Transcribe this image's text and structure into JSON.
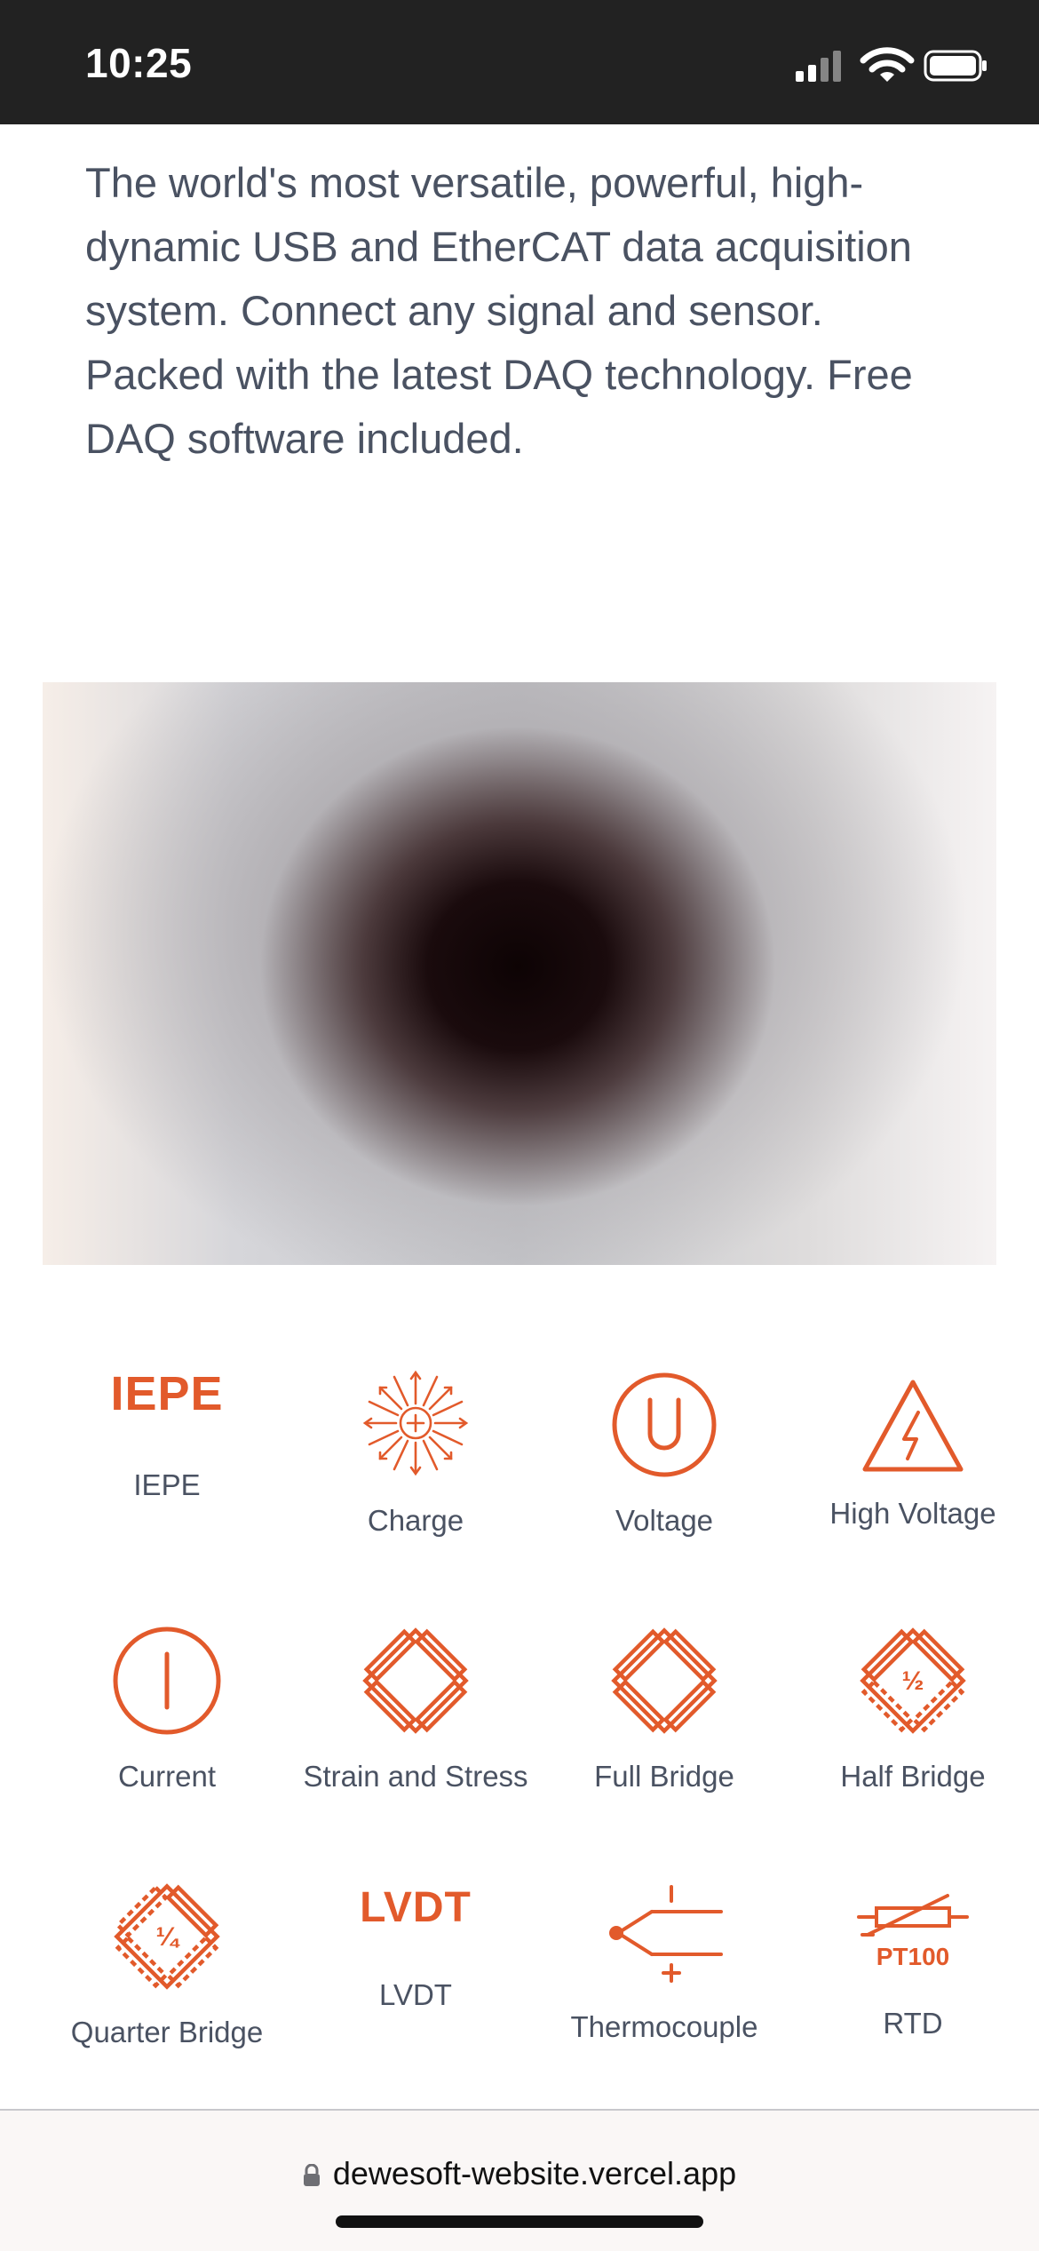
{
  "status_bar": {
    "time": "10:25",
    "signal_icon": "cellular-signal-icon",
    "wifi_icon": "wifi-icon",
    "battery_icon": "battery-icon"
  },
  "description": "The world's most versatile, powerful, high-dynamic USB and EtherCAT data acquisition system. Connect any signal and sensor. Packed with the latest DAQ technology. Free DAQ software included.",
  "hero": {
    "icon": "blurred-product-image"
  },
  "accent_color": "#e25a2b",
  "inputs": [
    {
      "label": "IEPE",
      "icon": "iepe-text-icon",
      "icon_text": "IEPE"
    },
    {
      "label": "Charge",
      "icon": "charge-icon"
    },
    {
      "label": "Voltage",
      "icon": "voltage-icon",
      "icon_text": "U"
    },
    {
      "label": "High Voltage",
      "icon": "high-voltage-icon"
    },
    {
      "label": "Current",
      "icon": "current-icon"
    },
    {
      "label": "Strain and Stress",
      "icon": "strain-bridge-icon"
    },
    {
      "label": "Full Bridge",
      "icon": "full-bridge-icon"
    },
    {
      "label": "Half Bridge",
      "icon": "half-bridge-icon",
      "icon_text": "½"
    },
    {
      "label": "Quarter Bridge",
      "icon": "quarter-bridge-icon",
      "icon_text": "¼"
    },
    {
      "label": "LVDT",
      "icon": "lvdt-text-icon",
      "icon_text": "LVDT"
    },
    {
      "label": "Thermocouple",
      "icon": "thermocouple-icon"
    },
    {
      "label": "RTD",
      "icon": "rtd-icon",
      "icon_text": "PT100"
    }
  ],
  "browser": {
    "url": "dewesoft-website.vercel.app",
    "lock_icon": "lock-icon"
  }
}
